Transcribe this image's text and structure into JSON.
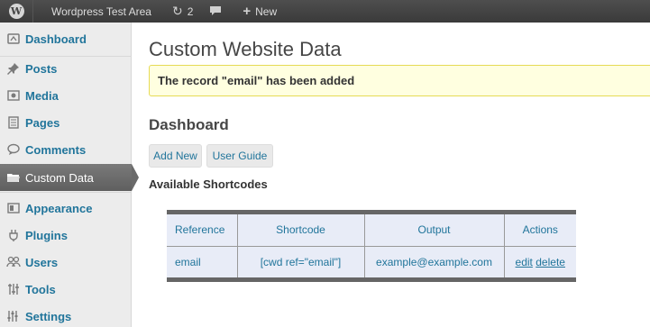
{
  "adminbar": {
    "site_name": "Wordpress Test Area",
    "updates_count": "2",
    "new_label": "New"
  },
  "sidebar": {
    "items": [
      {
        "label": "Dashboard",
        "icon": "dashboard-icon"
      },
      {
        "label": "Posts",
        "icon": "pin-icon"
      },
      {
        "label": "Media",
        "icon": "media-icon"
      },
      {
        "label": "Pages",
        "icon": "pages-icon"
      },
      {
        "label": "Comments",
        "icon": "comment-icon"
      },
      {
        "label": "Custom Data",
        "icon": "folder-icon"
      },
      {
        "label": "Appearance",
        "icon": "appearance-icon"
      },
      {
        "label": "Plugins",
        "icon": "plug-icon"
      },
      {
        "label": "Users",
        "icon": "users-icon"
      },
      {
        "label": "Tools",
        "icon": "tools-icon"
      },
      {
        "label": "Settings",
        "icon": "settings-icon"
      }
    ]
  },
  "main": {
    "page_title": "Custom Website Data",
    "notice": "The record \"email\" has been added",
    "section_title": "Dashboard",
    "buttons": {
      "add_new": "Add New",
      "user_guide": "User Guide"
    },
    "shortcodes_title": "Available Shortcodes",
    "table": {
      "headers": [
        "Reference",
        "Shortcode",
        "Output",
        "Actions"
      ],
      "rows": [
        {
          "reference": "email",
          "shortcode": "[cwd ref=\"email\"]",
          "output": "example@example.com",
          "edit": "edit",
          "delete": "delete"
        }
      ]
    }
  },
  "colors": {
    "link": "#21759b",
    "adminbar": "#464646",
    "notice_bg": "#ffffe0",
    "notice_border": "#e6db55",
    "current_menu": "#6a6a6a",
    "table_bg": "#e8ecf7"
  }
}
